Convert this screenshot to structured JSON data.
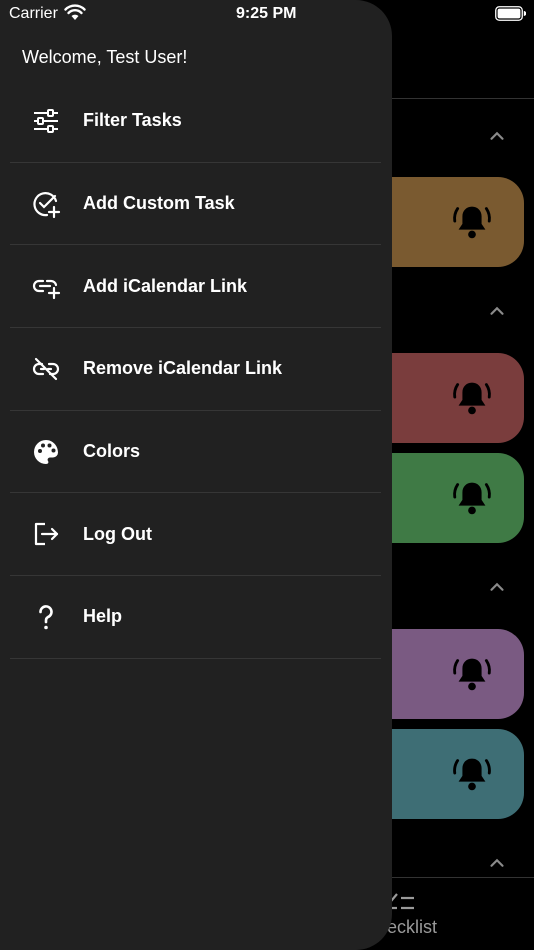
{
  "status_bar": {
    "carrier": "Carrier",
    "time": "9:25 PM",
    "wifi_icon": "wifi-icon",
    "battery_icon": "battery-icon"
  },
  "drawer": {
    "welcome": "Welcome, Test User!",
    "items": [
      {
        "label": "Filter Tasks",
        "icon": "sliders-icon"
      },
      {
        "label": "Add Custom Task",
        "icon": "check-plus-icon"
      },
      {
        "label": "Add iCalendar Link",
        "icon": "link-plus-icon"
      },
      {
        "label": "Remove iCalendar Link",
        "icon": "link-off-icon"
      },
      {
        "label": "Colors",
        "icon": "palette-icon"
      },
      {
        "label": "Log Out",
        "icon": "logout-icon"
      },
      {
        "label": "Help",
        "icon": "question-icon"
      }
    ]
  },
  "background": {
    "card_colors": [
      "#7a5a30",
      "#7a3d3d",
      "#3f7a45",
      "#7a5a82",
      "#3e6e75"
    ],
    "tab_label": "Checklist"
  }
}
